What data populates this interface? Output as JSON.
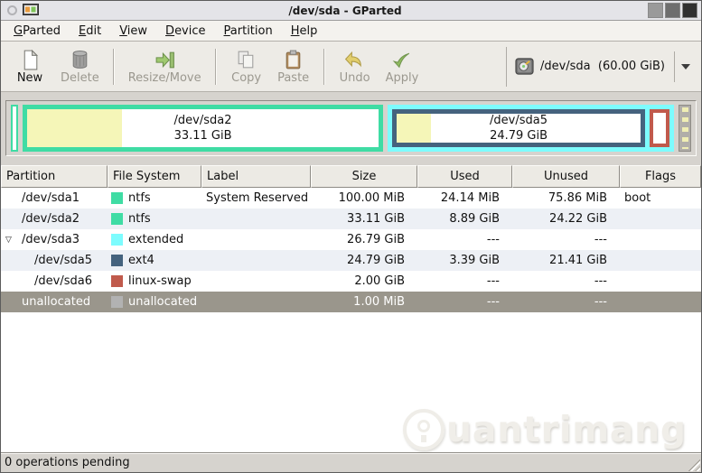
{
  "window": {
    "title": "/dev/sda - GParted"
  },
  "menu_bar": {
    "items": [
      {
        "mnemonic": "G",
        "rest": "Parted"
      },
      {
        "mnemonic": "E",
        "rest": "dit"
      },
      {
        "mnemonic": "V",
        "rest": "iew"
      },
      {
        "mnemonic": "D",
        "rest": "evice"
      },
      {
        "mnemonic": "P",
        "rest": "artition"
      },
      {
        "mnemonic": "H",
        "rest": "elp"
      }
    ]
  },
  "toolbar": {
    "buttons": [
      {
        "label": "New",
        "icon": "new-partition-icon",
        "enabled": true
      },
      {
        "label": "Delete",
        "icon": "delete-icon",
        "enabled": false
      },
      {
        "label": "Resize/Move",
        "icon": "resize-move-icon",
        "enabled": false
      },
      {
        "label": "Copy",
        "icon": "copy-icon",
        "enabled": false
      },
      {
        "label": "Paste",
        "icon": "paste-icon",
        "enabled": false
      },
      {
        "label": "Undo",
        "icon": "undo-icon",
        "enabled": false
      },
      {
        "label": "Apply",
        "icon": "apply-icon",
        "enabled": false
      }
    ],
    "device_selector": {
      "label": "/dev/sda  (60.00 GiB)",
      "icon": "hard-disk-icon"
    }
  },
  "disk_visual": {
    "segments": [
      {
        "name": "/dev/sda1",
        "fs": "ntfs"
      },
      {
        "name": "/dev/sda2",
        "fs": "ntfs",
        "size_label": "33.11 GiB",
        "used_pct": 27
      },
      {
        "name": "/dev/sda3",
        "fs": "extended"
      },
      {
        "name": "/dev/sda5",
        "fs": "ext4",
        "size_label": "24.79 GiB",
        "used_pct": 14
      },
      {
        "name": "/dev/sda6",
        "fs": "linux-swap"
      },
      {
        "name": "unallocated",
        "fs": "unallocated"
      }
    ]
  },
  "table": {
    "columns": [
      "Partition",
      "File System",
      "Label",
      "Size",
      "Used",
      "Unused",
      "Flags"
    ],
    "rows": [
      {
        "partition": "/dev/sda1",
        "fs": "ntfs",
        "label": "System Reserved",
        "size": "100.00 MiB",
        "used": "24.14 MiB",
        "unused": "75.86 MiB",
        "flags": "boot"
      },
      {
        "partition": "/dev/sda2",
        "fs": "ntfs",
        "label": "",
        "size": "33.11 GiB",
        "used": "8.89 GiB",
        "unused": "24.22 GiB",
        "flags": ""
      },
      {
        "partition": "/dev/sda3",
        "fs": "extended",
        "label": "",
        "size": "26.79 GiB",
        "used": "---",
        "unused": "---",
        "flags": ""
      },
      {
        "partition": "/dev/sda5",
        "fs": "ext4",
        "label": "",
        "size": "24.79 GiB",
        "used": "3.39 GiB",
        "unused": "21.41 GiB",
        "flags": ""
      },
      {
        "partition": "/dev/sda6",
        "fs": "linux-swap",
        "label": "",
        "size": "2.00 GiB",
        "used": "---",
        "unused": "---",
        "flags": ""
      },
      {
        "partition": "unallocated",
        "fs": "unallocated",
        "label": "",
        "size": "1.00 MiB",
        "used": "---",
        "unused": "---",
        "flags": ""
      }
    ]
  },
  "status_bar": {
    "text": "0 operations pending"
  },
  "watermark": {
    "text": "uantrimang"
  },
  "colors": {
    "ntfs": "#3FDCA4",
    "extended": "#7DFCFE",
    "ext4": "#45637E",
    "linux-swap": "#C05A4C",
    "unallocated": "#B2B2B2",
    "used": "#F5F6B8"
  }
}
